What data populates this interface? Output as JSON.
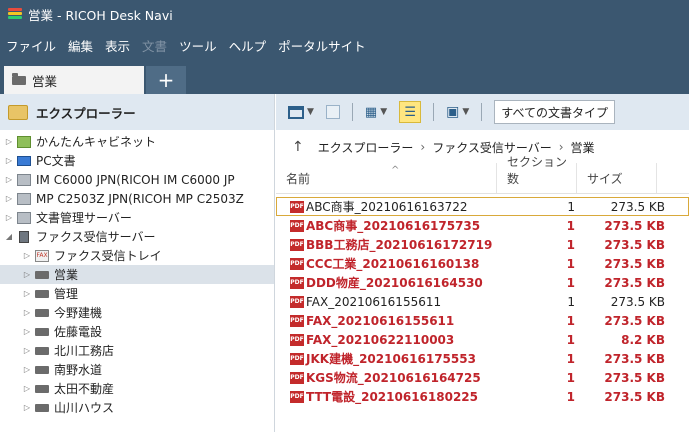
{
  "window": {
    "title": "営業 - RICOH Desk Navi",
    "logo_icon": "desknavi-logo-icon"
  },
  "menu": [
    {
      "label": "ファイル",
      "enabled": true
    },
    {
      "label": "編集",
      "enabled": true
    },
    {
      "label": "表示",
      "enabled": true
    },
    {
      "label": "文書",
      "enabled": false
    },
    {
      "label": "ツール",
      "enabled": true
    },
    {
      "label": "ヘルプ",
      "enabled": true
    },
    {
      "label": "ポータルサイト",
      "enabled": true
    }
  ],
  "tabs": {
    "active_label": "営業",
    "add_label": "+"
  },
  "explorer": {
    "header": "エクスプローラー",
    "tree": [
      {
        "label": "かんたんキャビネット",
        "icon": "cabinet-icon",
        "arrow": "▷",
        "indent": 0
      },
      {
        "label": "PC文書",
        "icon": "pc-icon",
        "arrow": "▷",
        "indent": 0
      },
      {
        "label": "IM C6000 JPN(RICOH IM C6000 JP",
        "icon": "mfp-icon",
        "arrow": "▷",
        "indent": 0
      },
      {
        "label": "MP C2503Z JPN(RICOH MP C2503Z",
        "icon": "mfp-icon",
        "arrow": "▷",
        "indent": 0
      },
      {
        "label": "文書管理サーバー",
        "icon": "docserver-icon",
        "arrow": "▷",
        "indent": 0
      },
      {
        "label": "ファクス受信サーバー",
        "icon": "server-icon",
        "arrow": "◢",
        "indent": 0
      },
      {
        "label": "ファクス受信トレイ",
        "icon": "fax-tray-icon",
        "arrow": "▷",
        "indent": 1
      },
      {
        "label": "営業",
        "icon": "tray-icon",
        "arrow": "▷",
        "indent": 1,
        "selected": true
      },
      {
        "label": "管理",
        "icon": "tray-icon",
        "arrow": "▷",
        "indent": 1
      },
      {
        "label": "今野建機",
        "icon": "tray-icon",
        "arrow": "▷",
        "indent": 1
      },
      {
        "label": "佐藤電設",
        "icon": "tray-icon",
        "arrow": "▷",
        "indent": 1
      },
      {
        "label": "北川工務店",
        "icon": "tray-icon",
        "arrow": "▷",
        "indent": 1
      },
      {
        "label": "南野水道",
        "icon": "tray-icon",
        "arrow": "▷",
        "indent": 1
      },
      {
        "label": "太田不動産",
        "icon": "tray-icon",
        "arrow": "▷",
        "indent": 1
      },
      {
        "label": "山川ハウス",
        "icon": "tray-icon",
        "arrow": "▷",
        "indent": 1
      }
    ]
  },
  "toolbar": {
    "doc_type_label": "すべての文書タイプ"
  },
  "breadcrumb": {
    "parts": [
      "エクスプローラー",
      "ファクス受信サーバー",
      "営業"
    ],
    "separator": "›"
  },
  "columns": {
    "name": "名前",
    "section_count": "セクション数",
    "size": "サイズ"
  },
  "files": [
    {
      "name": "ABC商事_20210616163722",
      "sections": "1",
      "size": "273.5 KB",
      "unread": false,
      "focused": true
    },
    {
      "name": "ABC商事_20210616175735",
      "sections": "1",
      "size": "273.5 KB",
      "unread": true
    },
    {
      "name": "BBB工務店_20210616172719",
      "sections": "1",
      "size": "273.5 KB",
      "unread": true
    },
    {
      "name": "CCC工業_20210616160138",
      "sections": "1",
      "size": "273.5 KB",
      "unread": true
    },
    {
      "name": "DDD物産_20210616164530",
      "sections": "1",
      "size": "273.5 KB",
      "unread": true
    },
    {
      "name": "FAX_20210616155611",
      "sections": "1",
      "size": "273.5 KB",
      "unread": false
    },
    {
      "name": "FAX_20210616155611",
      "sections": "1",
      "size": "273.5 KB",
      "unread": true
    },
    {
      "name": "FAX_20210622110003",
      "sections": "1",
      "size": "8.2 KB",
      "unread": true
    },
    {
      "name": "JKK建機_20210616175553",
      "sections": "1",
      "size": "273.5 KB",
      "unread": true
    },
    {
      "name": "KGS物流_20210616164725",
      "sections": "1",
      "size": "273.5 KB",
      "unread": true
    },
    {
      "name": "TTT電設_20210616180225",
      "sections": "1",
      "size": "273.5 KB",
      "unread": true
    }
  ],
  "colors": {
    "titlebar": "#3b5770",
    "pane_header": "#dfe8f1",
    "unread_text": "#c0242b",
    "selected_row": "#dbe2e9"
  }
}
